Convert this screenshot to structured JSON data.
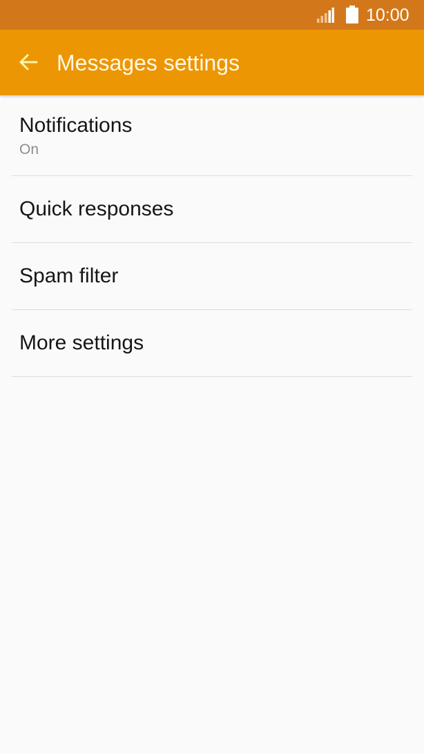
{
  "status_bar": {
    "time": "10:00",
    "signal_icon": "signal-icon",
    "battery_icon": "battery-icon",
    "color": "#d3781a"
  },
  "app_bar": {
    "title": "Messages settings",
    "back_icon": "back-arrow-icon",
    "color": "#ec9604"
  },
  "settings": {
    "items": [
      {
        "title": "Notifications",
        "subtitle": "On"
      },
      {
        "title": "Quick responses"
      },
      {
        "title": "Spam filter"
      },
      {
        "title": "More settings"
      }
    ]
  }
}
